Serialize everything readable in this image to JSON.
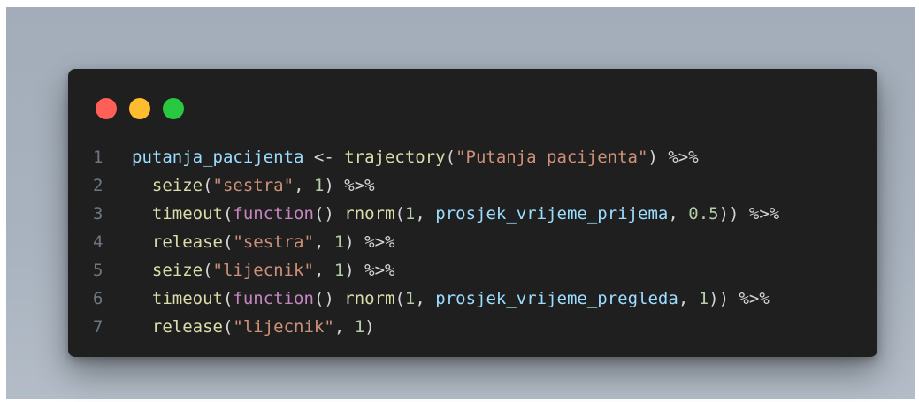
{
  "theme": {
    "background": "#a9b3bf",
    "editor_bg": "#1f1f1f",
    "traffic_lights": {
      "red": "#ff5f57",
      "yellow": "#febc2e",
      "green": "#28c840"
    },
    "token_colors": {
      "var": "#9cdcfe",
      "op": "#d4d4d4",
      "fn": "#dcdcaa",
      "str": "#ce9178",
      "num": "#b5cea8",
      "kw": "#c586c0",
      "pun": "#d4d4d4",
      "line_number": "#6e7681"
    }
  },
  "code_lines": [
    {
      "n": "1",
      "tokens": [
        {
          "t": "putanja_pacijenta",
          "c": "var"
        },
        {
          "t": " <- ",
          "c": "op"
        },
        {
          "t": "trajectory",
          "c": "fn"
        },
        {
          "t": "(",
          "c": "pun"
        },
        {
          "t": "\"Putanja pacijenta\"",
          "c": "str"
        },
        {
          "t": ") ",
          "c": "pun"
        },
        {
          "t": "%>%",
          "c": "op"
        }
      ]
    },
    {
      "n": "2",
      "tokens": [
        {
          "t": "  ",
          "c": "pun"
        },
        {
          "t": "seize",
          "c": "fn"
        },
        {
          "t": "(",
          "c": "pun"
        },
        {
          "t": "\"sestra\"",
          "c": "str"
        },
        {
          "t": ", ",
          "c": "pun"
        },
        {
          "t": "1",
          "c": "num"
        },
        {
          "t": ") ",
          "c": "pun"
        },
        {
          "t": "%>%",
          "c": "op"
        }
      ]
    },
    {
      "n": "3",
      "tokens": [
        {
          "t": "  ",
          "c": "pun"
        },
        {
          "t": "timeout",
          "c": "fn"
        },
        {
          "t": "(",
          "c": "pun"
        },
        {
          "t": "function",
          "c": "kw"
        },
        {
          "t": "() ",
          "c": "pun"
        },
        {
          "t": "rnorm",
          "c": "fn"
        },
        {
          "t": "(",
          "c": "pun"
        },
        {
          "t": "1",
          "c": "num"
        },
        {
          "t": ", ",
          "c": "pun"
        },
        {
          "t": "prosjek_vrijeme_prijema",
          "c": "var"
        },
        {
          "t": ", ",
          "c": "pun"
        },
        {
          "t": "0.5",
          "c": "num"
        },
        {
          "t": ")) ",
          "c": "pun"
        },
        {
          "t": "%>%",
          "c": "op"
        }
      ]
    },
    {
      "n": "4",
      "tokens": [
        {
          "t": "  ",
          "c": "pun"
        },
        {
          "t": "release",
          "c": "fn"
        },
        {
          "t": "(",
          "c": "pun"
        },
        {
          "t": "\"sestra\"",
          "c": "str"
        },
        {
          "t": ", ",
          "c": "pun"
        },
        {
          "t": "1",
          "c": "num"
        },
        {
          "t": ") ",
          "c": "pun"
        },
        {
          "t": "%>%",
          "c": "op"
        }
      ]
    },
    {
      "n": "5",
      "tokens": [
        {
          "t": "  ",
          "c": "pun"
        },
        {
          "t": "seize",
          "c": "fn"
        },
        {
          "t": "(",
          "c": "pun"
        },
        {
          "t": "\"lijecnik\"",
          "c": "str"
        },
        {
          "t": ", ",
          "c": "pun"
        },
        {
          "t": "1",
          "c": "num"
        },
        {
          "t": ") ",
          "c": "pun"
        },
        {
          "t": "%>%",
          "c": "op"
        }
      ]
    },
    {
      "n": "6",
      "tokens": [
        {
          "t": "  ",
          "c": "pun"
        },
        {
          "t": "timeout",
          "c": "fn"
        },
        {
          "t": "(",
          "c": "pun"
        },
        {
          "t": "function",
          "c": "kw"
        },
        {
          "t": "() ",
          "c": "pun"
        },
        {
          "t": "rnorm",
          "c": "fn"
        },
        {
          "t": "(",
          "c": "pun"
        },
        {
          "t": "1",
          "c": "num"
        },
        {
          "t": ", ",
          "c": "pun"
        },
        {
          "t": "prosjek_vrijeme_pregleda",
          "c": "var"
        },
        {
          "t": ", ",
          "c": "pun"
        },
        {
          "t": "1",
          "c": "num"
        },
        {
          "t": ")) ",
          "c": "pun"
        },
        {
          "t": "%>%",
          "c": "op"
        }
      ]
    },
    {
      "n": "7",
      "tokens": [
        {
          "t": "  ",
          "c": "pun"
        },
        {
          "t": "release",
          "c": "fn"
        },
        {
          "t": "(",
          "c": "pun"
        },
        {
          "t": "\"lijecnik\"",
          "c": "str"
        },
        {
          "t": ", ",
          "c": "pun"
        },
        {
          "t": "1",
          "c": "num"
        },
        {
          "t": ")",
          "c": "pun"
        }
      ]
    }
  ]
}
